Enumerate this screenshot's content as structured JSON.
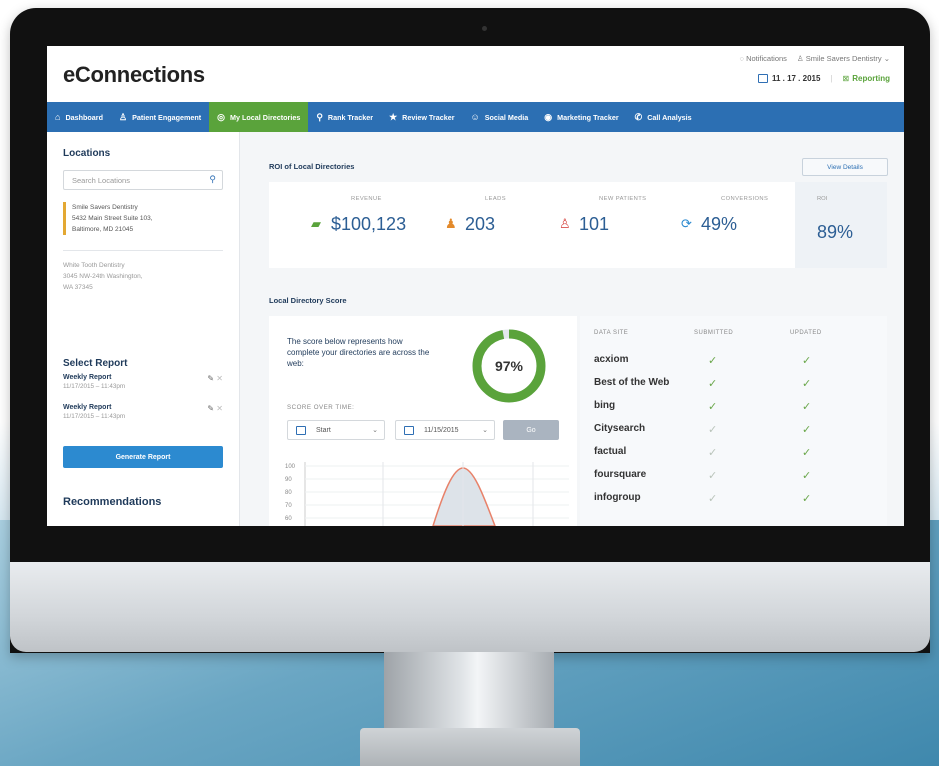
{
  "app": {
    "logo": "eConnections"
  },
  "topbar": {
    "notifications": "Notifications",
    "practice": "Smile Savers Dentistry",
    "date": "11 . 17 . 2015",
    "reporting": "Reporting"
  },
  "nav": [
    {
      "label": "Dashboard",
      "icon": "dashboard-icon",
      "glyph": "⌂"
    },
    {
      "label": "Patient Engagement",
      "icon": "person-icon",
      "glyph": "♙"
    },
    {
      "label": "My Local Directories",
      "icon": "globe-icon",
      "glyph": "◎",
      "active": true
    },
    {
      "label": "Rank Tracker",
      "icon": "map-pin-icon",
      "glyph": "⚲"
    },
    {
      "label": "Review Tracker",
      "icon": "star-icon",
      "glyph": "★"
    },
    {
      "label": "Social Media",
      "icon": "chat-icon",
      "glyph": "☺"
    },
    {
      "label": "Marketing Tracker",
      "icon": "target-icon",
      "glyph": "◉"
    },
    {
      "label": "Call Analysis",
      "icon": "phone-icon",
      "glyph": "✆"
    }
  ],
  "sidebar": {
    "locations_title": "Locations",
    "search_placeholder": "Search Locations",
    "location1": {
      "name": "Smile Savers Dentistry",
      "address1": "5432 Main Street Suite 103,",
      "address2": "Baltimore, MD 21045"
    },
    "location2": {
      "name": "White Tooth Dentistry",
      "address1": "3045 NW-24th Washington,",
      "address2": "WA 37345"
    },
    "select_report_title": "Select Report",
    "reports": [
      {
        "title": "Weekly Report",
        "date": "11/17/2015 – 11:43pm"
      },
      {
        "title": "Weekly Report",
        "date": "11/17/2015 – 11:43pm"
      }
    ],
    "generate_label": "Generate Report",
    "recommendations_title": "Recommendations"
  },
  "roi": {
    "title": "ROI of Local Directories",
    "view_details": "View Details",
    "metrics": [
      {
        "label": "Revenue",
        "value": "$100,123",
        "icon": "money-icon",
        "color": "#5aa33b"
      },
      {
        "label": "Leads",
        "value": "203",
        "icon": "leads-icon",
        "color": "#e38a2b"
      },
      {
        "label": "New Patients",
        "value": "101",
        "icon": "new-patient-icon",
        "color": "#d9534f"
      },
      {
        "label": "Conversions",
        "value": "49%",
        "icon": "refresh-icon",
        "color": "#2c8ad0"
      }
    ],
    "roi_label": "ROI",
    "roi_value": "89%"
  },
  "score": {
    "title": "Local Directory Score",
    "description": "The score below represents how complete your directories are across the web:",
    "percent": "97%",
    "percent_value": 0.97,
    "over_time_label": "SCORE OVER TIME:",
    "start_label": "Start",
    "end_date": "11/15/2015",
    "go_label": "Go",
    "y_ticks": [
      "100",
      "90",
      "80",
      "70",
      "60"
    ]
  },
  "sites": {
    "headers": {
      "site": "DATA SITE",
      "submitted": "SUBMITTED",
      "updated": "UPDATED"
    },
    "rows": [
      {
        "name": "acxiom",
        "submitted": true,
        "updated": true
      },
      {
        "name": "Best of the Web",
        "submitted": true,
        "updated": true
      },
      {
        "name": "bing",
        "submitted": true,
        "updated": true
      },
      {
        "name": "Citysearch",
        "submitted": false,
        "updated": true
      },
      {
        "name": "factual",
        "submitted": false,
        "updated": true
      },
      {
        "name": "foursquare",
        "submitted": false,
        "updated": true
      },
      {
        "name": "infogroup",
        "submitted": false,
        "updated": true
      }
    ]
  },
  "colors": {
    "nav_blue": "#2c6fb3",
    "active_green": "#5aa33b",
    "value_blue": "#2c5e94"
  }
}
